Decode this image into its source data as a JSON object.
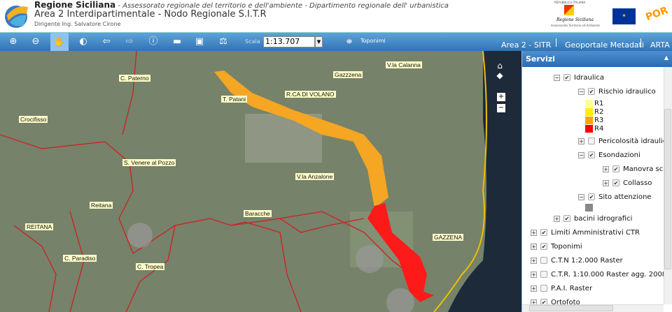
{
  "header": {
    "org": "Regione Siciliana",
    "subtitle": " - Assessorato regionale del territorio e dell'ambiente - Dipartimento regionale dell' urbanistica",
    "title": "Area 2 Interdipartimentale  - Nodo Regionale S.I.T.R",
    "director": "Dirigente Ing. Salvatore Cirone",
    "logos": {
      "republic": "REPUBBLICA ITALIANA",
      "regione": "Regione Siciliana",
      "assessorato": "Assessorato Territorio ed Ambiente",
      "por": "POR"
    }
  },
  "toolbar": {
    "tools": [
      "zoom-in-icon",
      "zoom-out-icon",
      "pan-hand-icon",
      "zoom-extent-globe-icon",
      "back-arrow-icon",
      "forward-arrow-icon",
      "info-icon",
      "window-icon",
      "zoom-layer-icon",
      "measure-icon"
    ],
    "scale_label": "Scala",
    "scale_value": "1:13.707",
    "toponimi": "Toponimi",
    "nav": [
      "Area 2 - SITR",
      "Geoportale Metadati",
      "ARTA"
    ]
  },
  "map": {
    "labels": [
      "C. Paterno",
      "T. Patani",
      "R.CA DI VOLANO",
      "Gazzzena",
      "V.la Calanna",
      "Crocifisso",
      "S. Venere al Pozzo",
      "V.la Anzalone",
      "Reitana",
      "Baracche",
      "REITANA",
      "GAZZENA",
      "C. Paradiso",
      "C. Tropea"
    ],
    "colors": {
      "r3": "#f5a623",
      "r4": "#ff1a1a",
      "boundary": "#d02020",
      "coast": "#f0c000"
    }
  },
  "panel": {
    "title": "Servizi",
    "tree": [
      {
        "label": "Idraulica",
        "toggle": "minus",
        "checked": true
      },
      {
        "label": "Rischio idraulico",
        "toggle": "minus",
        "checked": true
      },
      {
        "label": "R1",
        "swatch": "#ffff99"
      },
      {
        "label": "R2",
        "swatch": "#ffee00"
      },
      {
        "label": "R3",
        "swatch": "#ffa500"
      },
      {
        "label": "R4",
        "swatch": "#ff0000"
      },
      {
        "label": "Pericolosità idraulica",
        "toggle": "plus",
        "checked": false
      },
      {
        "label": "Esondazioni",
        "toggle": "minus",
        "checked": true
      },
      {
        "label": "Manovra scarico",
        "toggle": "plus",
        "checked": true
      },
      {
        "label": "Collasso",
        "toggle": "plus",
        "checked": true
      },
      {
        "label": "Sito attenzione",
        "toggle": "minus",
        "checked": true
      },
      {
        "label": "",
        "swatch": "#888888"
      },
      {
        "label": "bacini idrografici",
        "toggle": "plus",
        "checked": true
      },
      {
        "label": "Limiti Amministrativi CTR",
        "toggle": "plus",
        "checked": true
      },
      {
        "label": "Toponimi",
        "toggle": "plus",
        "checked": true
      },
      {
        "label": "C.T.N 1:2.000 Raster",
        "toggle": "plus",
        "checked": false
      },
      {
        "label": "C.T.R. 1:10.000 Raster agg. 2008",
        "toggle": "plus",
        "checked": false
      },
      {
        "label": "P.A.I. Raster",
        "toggle": "plus",
        "checked": false
      },
      {
        "label": "Ortofoto",
        "toggle": "plus",
        "checked": true
      }
    ]
  }
}
